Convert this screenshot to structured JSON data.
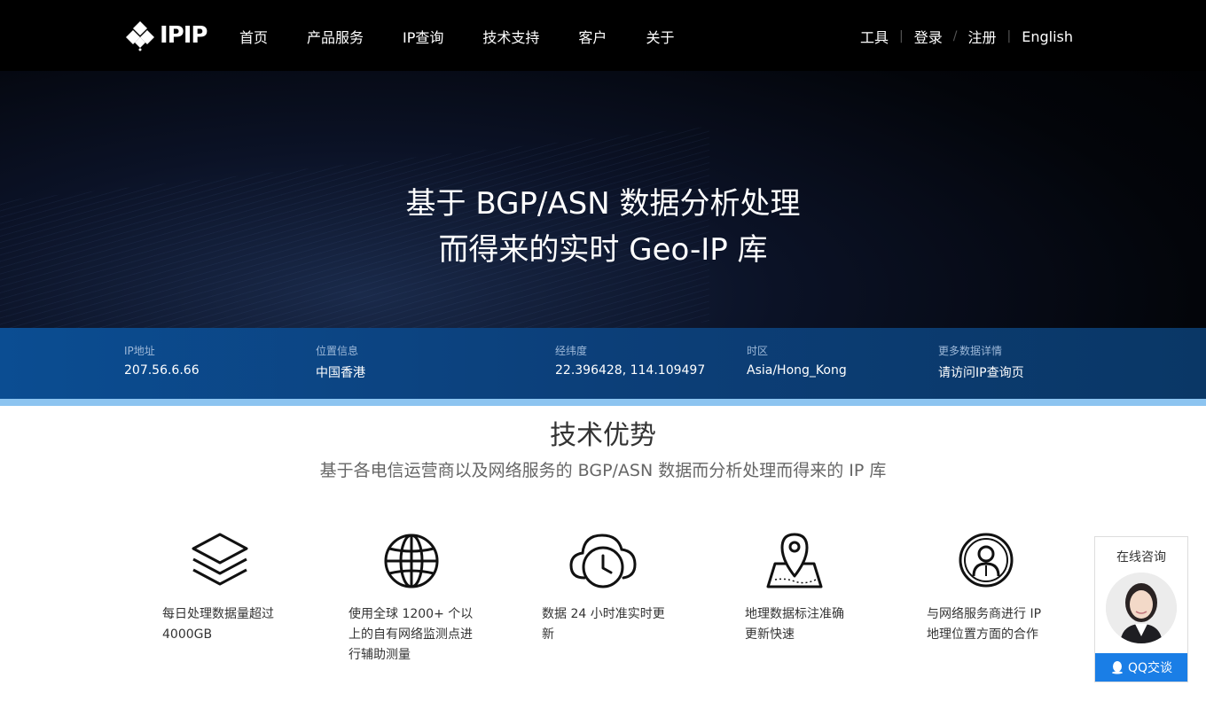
{
  "header": {
    "logo_text": "IPIP",
    "nav": [
      "首页",
      "产品服务",
      "IP查询",
      "技术支持",
      "客户",
      "关于"
    ],
    "right_links": [
      "工具",
      "登录",
      "注册",
      "English"
    ]
  },
  "hero": {
    "line1": "基于 BGP/ASN 数据分析处理",
    "line2": "而得来的实时 Geo-IP 库"
  },
  "ip_info": [
    {
      "label": "IP地址",
      "value": "207.56.6.66"
    },
    {
      "label": "位置信息",
      "value": "中国香港"
    },
    {
      "label": "经纬度",
      "value": "22.396428, 114.109497"
    },
    {
      "label": "时区",
      "value": "Asia/Hong_Kong"
    },
    {
      "label": "更多数据详情",
      "value": "请访问IP查询页"
    }
  ],
  "advantages": {
    "title": "技术优势",
    "subtitle": "基于各电信运营商以及网络服务的 BGP/ASN 数据而分析处理而得来的 IP 库",
    "features": [
      {
        "icon": "layers-icon",
        "lines": [
          "每日处理数据量超过",
          "4000GB"
        ]
      },
      {
        "icon": "globe-icon",
        "lines": [
          "使用全球 1200+ 个以",
          "上的自有网络监测点进",
          "行辅助测量"
        ]
      },
      {
        "icon": "cloud-clock-icon",
        "lines": [
          "数据 24 小时准实时更",
          "新"
        ]
      },
      {
        "icon": "map-pin-icon",
        "lines": [
          "地理数据标注准确",
          "更新快速"
        ]
      },
      {
        "icon": "user-circle-icon",
        "lines": [
          "与网络服务商进行 IP",
          "地理位置方面的合作"
        ]
      }
    ]
  },
  "chat": {
    "title": "在线咨询",
    "button": "QQ交谈"
  }
}
